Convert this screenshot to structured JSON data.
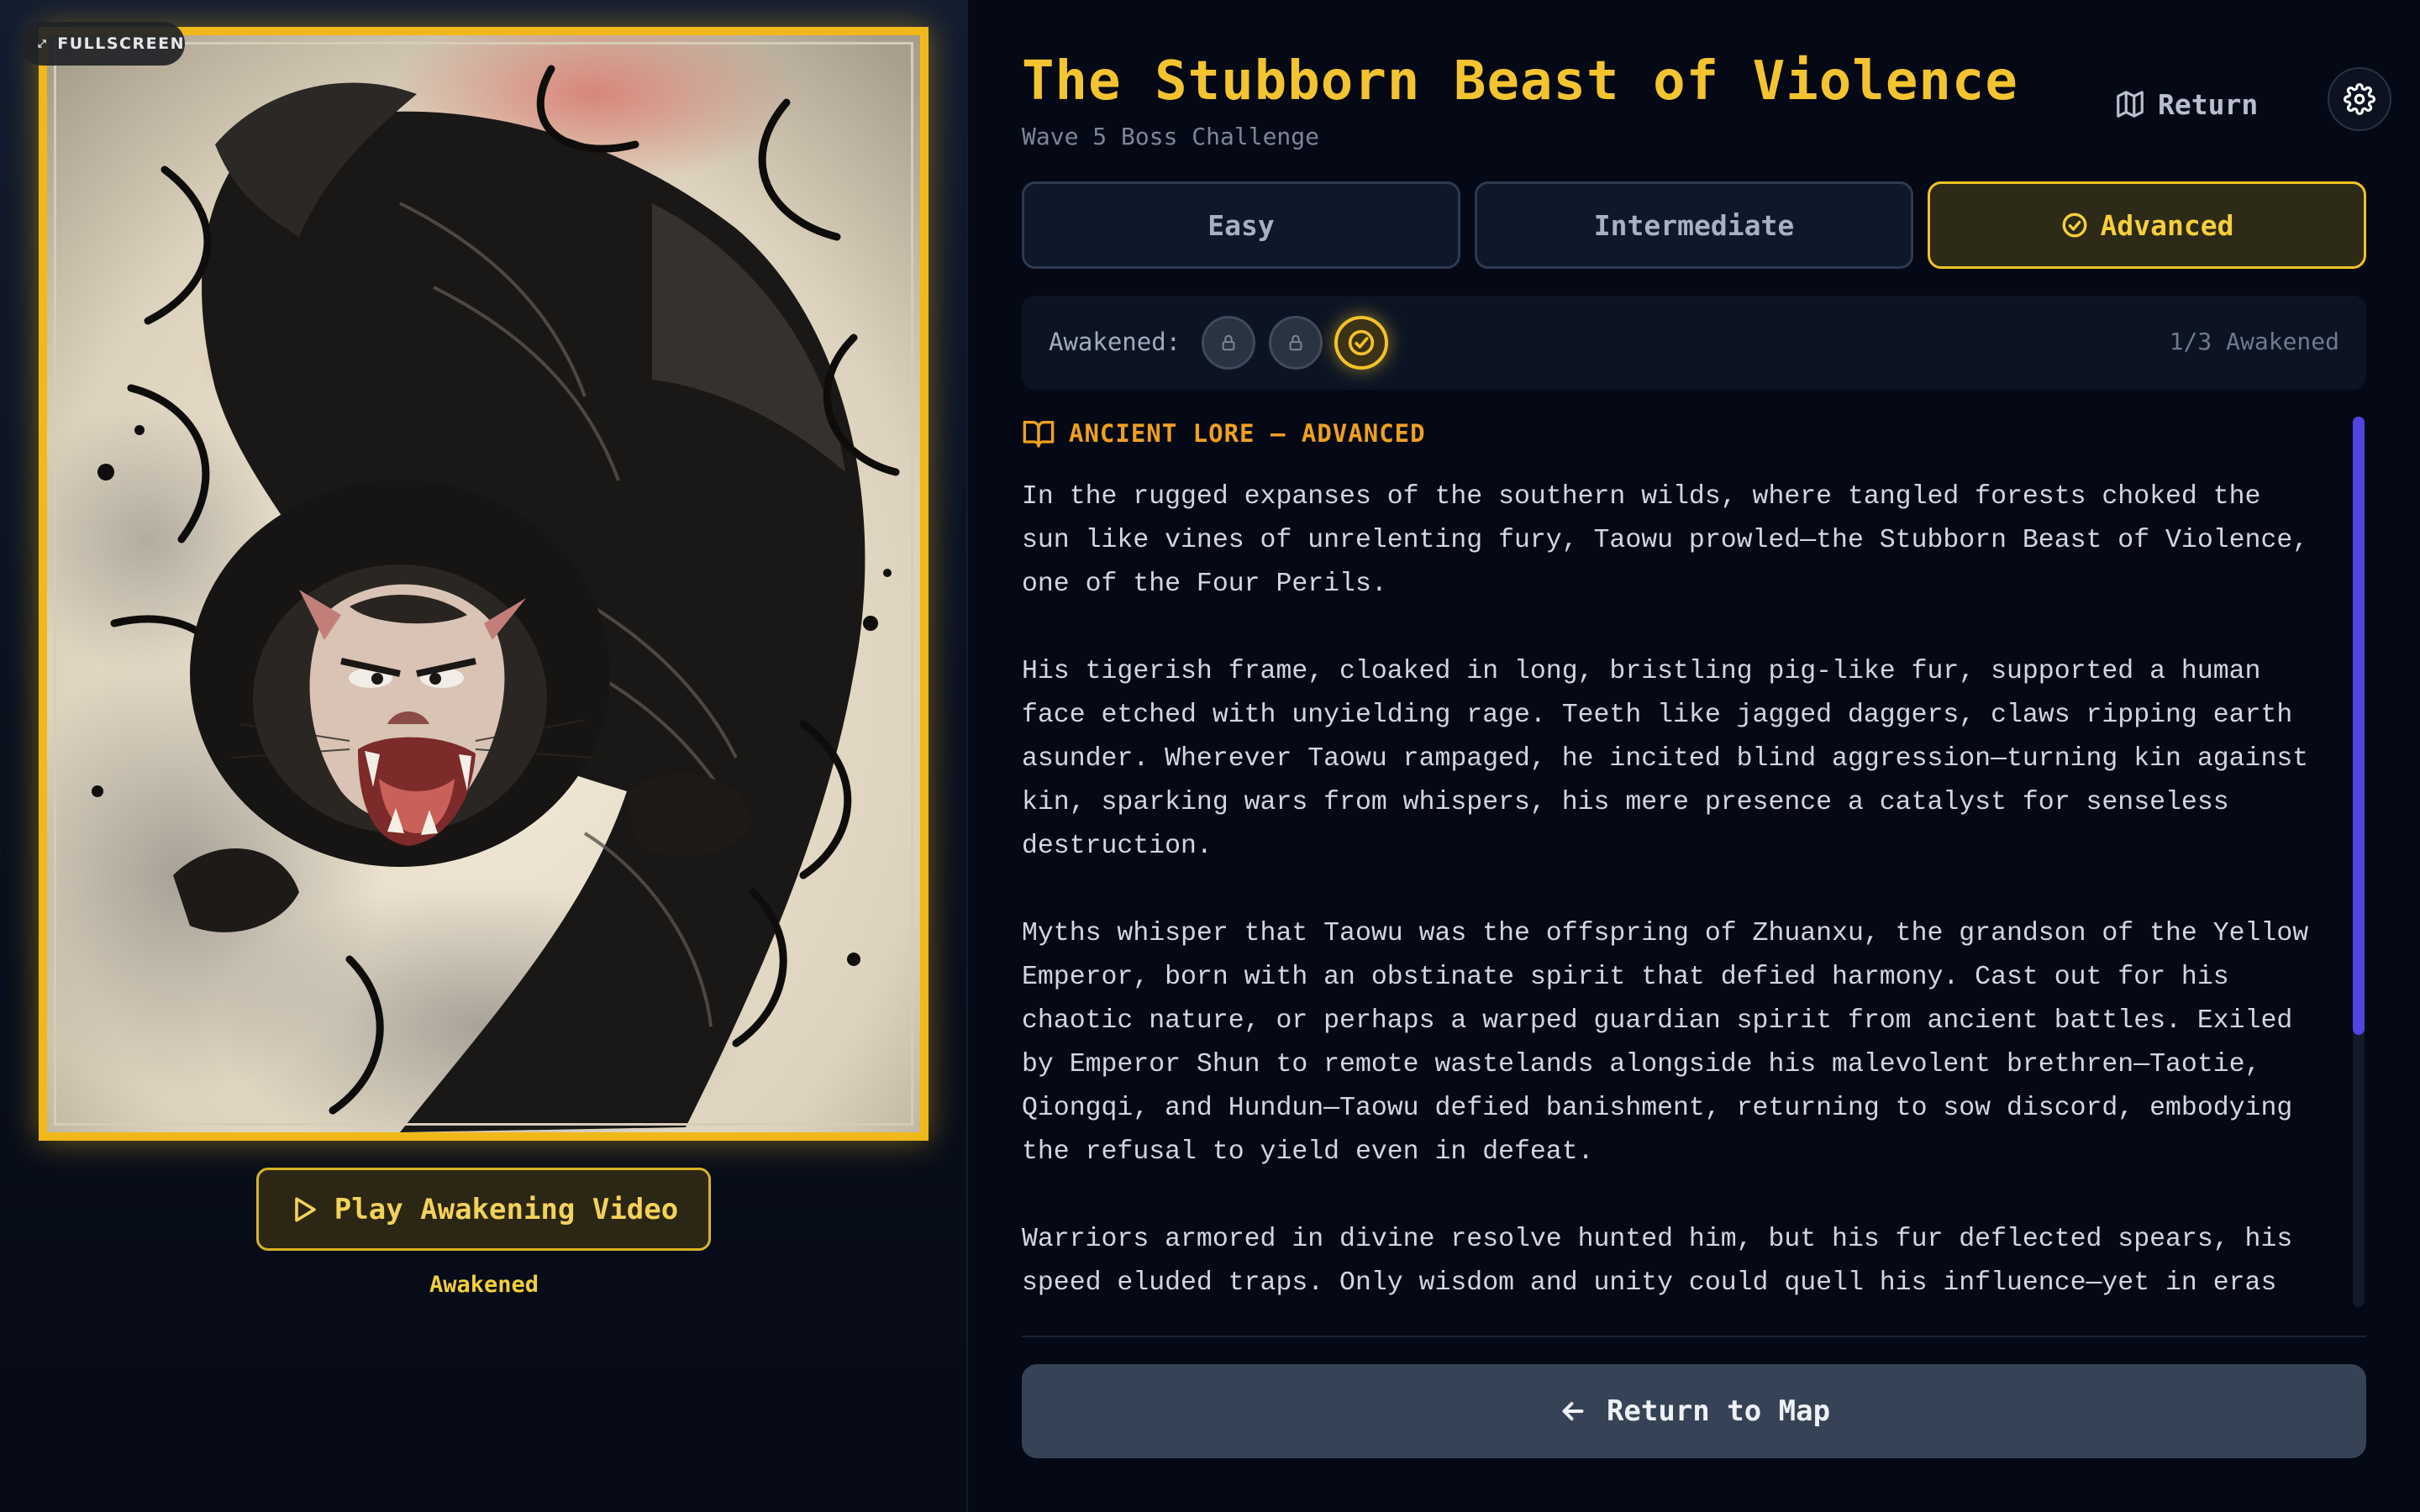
{
  "left": {
    "fullscreen_label": "FULLSCREEN",
    "play_label": "Play Awakening Video",
    "status_caption": "Awakened",
    "artwork_alt": "Taowu beast ink painting",
    "frame_color": "#f1b81a"
  },
  "header": {
    "title": "The Stubborn Beast of Violence",
    "subtitle": "Wave 5 Boss Challenge",
    "return_label": "Return",
    "return_icon": "map-icon",
    "settings_icon": "gear-icon"
  },
  "difficulty": {
    "tabs": [
      {
        "label": "Easy",
        "selected": false
      },
      {
        "label": "Intermediate",
        "selected": false
      },
      {
        "label": "Advanced",
        "selected": true
      }
    ],
    "accent": "#f1c227"
  },
  "awakening": {
    "label": "Awakened:",
    "orbs": [
      {
        "state": "locked",
        "icon": "lock-icon"
      },
      {
        "state": "locked",
        "icon": "lock-icon"
      },
      {
        "state": "awakened",
        "icon": "check-circle-icon"
      }
    ],
    "count_text": "1/3 Awakened"
  },
  "lore": {
    "heading": "ANCIENT LORE – ADVANCED",
    "heading_icon": "book-icon",
    "paragraphs": [
      "In the rugged expanses of the southern wilds, where tangled forests choked the sun like vines of unrelenting fury, Taowu prowled—the Stubborn Beast of Violence, one of the Four Perils.",
      "His tigerish frame, cloaked in long, bristling pig-like fur, supported a human face etched with unyielding rage. Teeth like jagged daggers, claws ripping earth asunder. Wherever Taowu rampaged, he incited blind aggression—turning kin against kin, sparking wars from whispers, his mere presence a catalyst for senseless destruction.",
      "Myths whisper that Taowu was the offspring of Zhuanxu, the grandson of the Yellow Emperor, born with an obstinate spirit that defied harmony. Cast out for his chaotic nature, or perhaps a warped guardian spirit from ancient battles. Exiled by Emperor Shun to remote wastelands alongside his malevolent brethren—Taotie, Qiongqi, and Hundun—Taowu defied banishment, returning to sow discord, embodying the refusal to yield even in defeat.",
      "Warriors armored in divine resolve hunted him, but his fur deflected spears, his speed eluded traps. Only wisdom and unity could quell his influence—yet in eras"
    ]
  },
  "footer": {
    "return_map_label": "Return to Map",
    "return_map_icon": "arrow-left-icon"
  }
}
